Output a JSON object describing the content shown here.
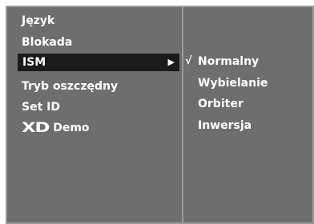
{
  "menu": {
    "items": [
      {
        "label": "Język"
      },
      {
        "label": "Blokada"
      },
      {
        "label": "ISM",
        "submenu_arrow": "▶"
      },
      {
        "label": "Tryb oszczędny"
      },
      {
        "label": "Set ID"
      },
      {
        "label": "Demo",
        "logo": "XD"
      }
    ],
    "selected": "ISM"
  },
  "ism_options": {
    "check_mark": "√",
    "items": [
      {
        "label": "Normalny",
        "checked": true
      },
      {
        "label": "Wybielanie",
        "checked": false
      },
      {
        "label": "Orbiter",
        "checked": false
      },
      {
        "label": "Inwersja",
        "checked": false
      }
    ]
  },
  "colors": {
    "panel": "#6e6e6e",
    "panel_border": "#9a9a9a",
    "selection": "#1a1a1a",
    "text": "#ffffff",
    "background": "#ffffff"
  }
}
